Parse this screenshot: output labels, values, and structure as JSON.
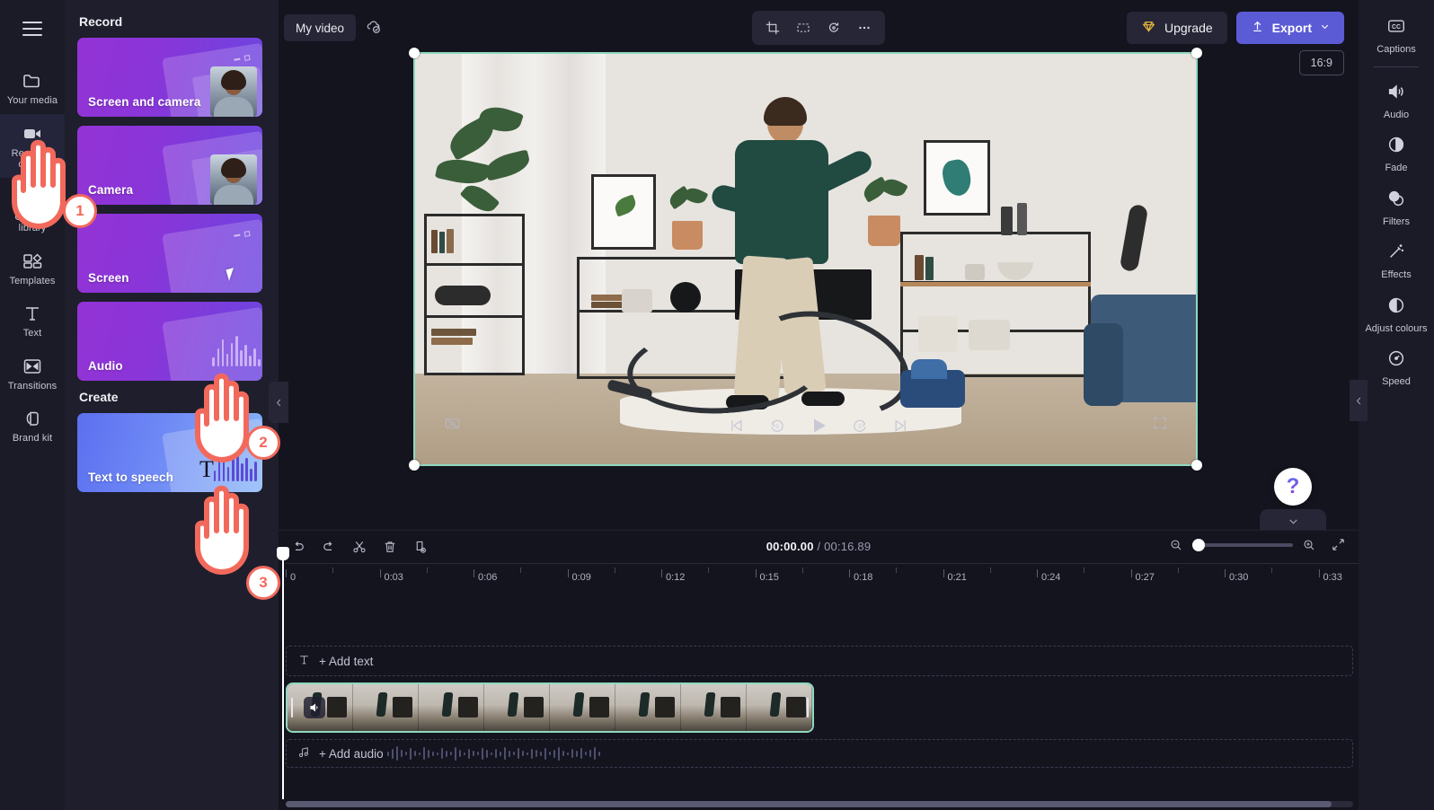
{
  "rail": {
    "menu_icon": "hamburger-icon",
    "items": [
      {
        "label": "Your media",
        "icon": "folder-icon",
        "active": false
      },
      {
        "label": "Record & create",
        "icon": "video-camera-icon",
        "active": true
      },
      {
        "label": "Content library",
        "icon": "image-stack-icon",
        "active": false
      },
      {
        "label": "Templates",
        "icon": "templates-icon",
        "active": false
      },
      {
        "label": "Text",
        "icon": "text-icon",
        "active": false
      },
      {
        "label": "Transitions",
        "icon": "transitions-icon",
        "active": false
      },
      {
        "label": "Brand kit",
        "icon": "brand-kit-icon",
        "active": false
      }
    ]
  },
  "panel": {
    "section_record": "Record",
    "section_create": "Create",
    "cards": [
      {
        "label": "Screen and camera",
        "kind": "rec"
      },
      {
        "label": "Camera",
        "kind": "rec"
      },
      {
        "label": "Screen",
        "kind": "rec"
      },
      {
        "label": "Audio",
        "kind": "rec"
      }
    ],
    "create_cards": [
      {
        "label": "Text to speech",
        "kind": "create"
      }
    ],
    "collapse_icon": "chevron-left-icon"
  },
  "topbar": {
    "video_name": "My video",
    "save_status_icon": "cloud-check-icon",
    "tools": [
      {
        "name": "crop-icon"
      },
      {
        "name": "fit-to-frame-icon"
      },
      {
        "name": "rotate-icon"
      },
      {
        "name": "more-options-icon"
      }
    ],
    "upgrade_label": "Upgrade",
    "upgrade_icon": "diamond-icon",
    "export_label": "Export",
    "export_icon": "upload-icon",
    "export_chevron": "chevron-down-icon",
    "aspect_ratio": "16:9"
  },
  "player": {
    "captions_off_icon": "captions-off-icon",
    "skip_start_icon": "skip-to-start-icon",
    "back5_icon": "rewind-5s-icon",
    "play_icon": "play-icon",
    "fwd5_icon": "forward-5s-icon",
    "skip_end_icon": "skip-to-end-icon",
    "fullscreen_icon": "fullscreen-icon"
  },
  "help": {
    "label": "?",
    "collapse_icon": "chevron-down-icon"
  },
  "timeline": {
    "tools": [
      {
        "name": "undo-icon"
      },
      {
        "name": "redo-icon"
      },
      {
        "name": "split-icon"
      },
      {
        "name": "delete-icon"
      },
      {
        "name": "duplicate-icon"
      }
    ],
    "current_time": "00:00.00",
    "separator": "/",
    "total_time": "00:16.89",
    "zoom_out_icon": "zoom-out-icon",
    "zoom_in_icon": "zoom-in-icon",
    "fit_icon": "fit-timeline-icon",
    "zoom_value": 0,
    "ruler_labels": [
      "0",
      "0:03",
      "0:06",
      "0:09",
      "0:12",
      "0:15",
      "0:18",
      "0:21",
      "0:24",
      "0:27",
      "0:30",
      "0:33"
    ],
    "add_text_label": "+ Add text",
    "add_text_icon": "text-icon",
    "add_audio_label": "+ Add audio",
    "add_audio_icon": "music-note-icon",
    "clip_audio_icon": "speaker-icon"
  },
  "props": {
    "items": [
      {
        "label": "Captions",
        "icon": "cc-icon"
      },
      {
        "label": "Audio",
        "icon": "speaker-icon"
      },
      {
        "label": "Fade",
        "icon": "fade-icon"
      },
      {
        "label": "Filters",
        "icon": "filters-icon"
      },
      {
        "label": "Effects",
        "icon": "effects-wand-icon"
      },
      {
        "label": "Adjust colours",
        "icon": "contrast-icon"
      },
      {
        "label": "Speed",
        "icon": "speedometer-icon"
      }
    ],
    "collapse_icon": "chevron-left-icon"
  },
  "tutorial": {
    "steps": [
      {
        "number": "1"
      },
      {
        "number": "2"
      },
      {
        "number": "3"
      }
    ],
    "accent": "#f2695c"
  },
  "colors": {
    "accent": "#5b5bd6",
    "selection": "#8fd9bf",
    "panel_bg": "#1e1e2c",
    "rail_bg": "#1b1b28",
    "stage_bg": "#14141f",
    "badge": "#f2695c"
  }
}
